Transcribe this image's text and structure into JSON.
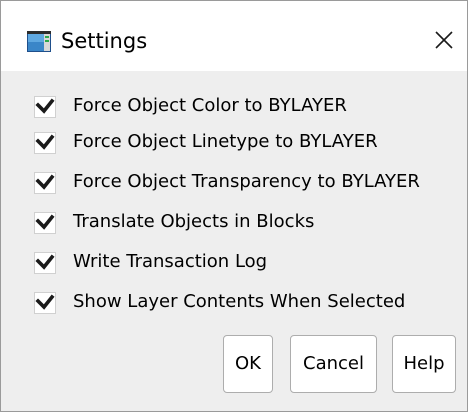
{
  "window": {
    "title": "Settings",
    "app_icon": "settings-app-icon",
    "close_icon": "close-icon"
  },
  "options": [
    {
      "label": "Force Object Color to BYLAYER",
      "checked": true
    },
    {
      "label": "Force Object Linetype to BYLAYER",
      "checked": true
    },
    {
      "label": "Force Object Transparency to BYLAYER",
      "checked": true
    },
    {
      "label": "Translate Objects in Blocks",
      "checked": true
    },
    {
      "label": "Write Transaction Log",
      "checked": true
    },
    {
      "label": "Show Layer Contents When Selected",
      "checked": true
    }
  ],
  "buttons": {
    "ok": "OK",
    "cancel": "Cancel",
    "help": "Help"
  },
  "colors": {
    "client_background": "#eeeeee",
    "checkmark": "#1a1a1a"
  }
}
